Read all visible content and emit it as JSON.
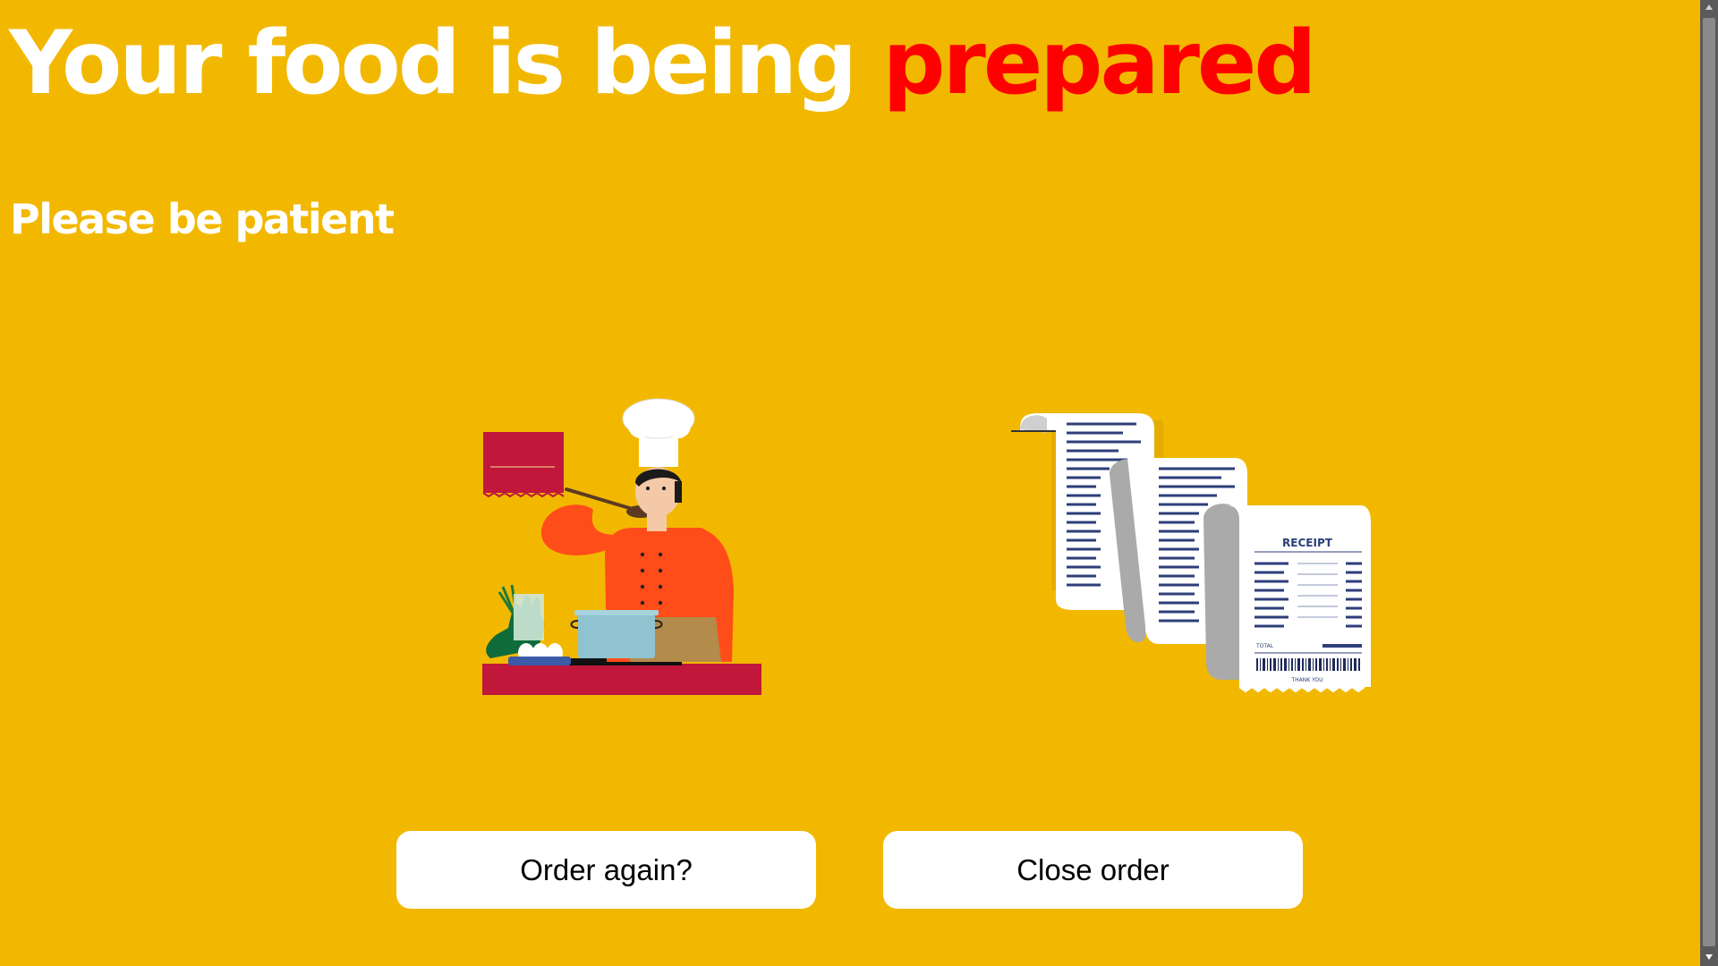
{
  "headline": {
    "text_main": "Your food is being ",
    "text_accent": "prepared",
    "accent_color": "#ff0000"
  },
  "subhead": {
    "text": "Please be patient"
  },
  "illustrations": {
    "chef": "chef-tasting-icon",
    "receipt": "receipt-icon",
    "receipt_title": "RECEIPT",
    "receipt_total": "TOTAL",
    "receipt_thanks": "THANK YOU"
  },
  "actions": {
    "order_again_label": "Order again?",
    "close_order_label": "Close order"
  },
  "colors": {
    "background": "#f2b800",
    "text": "#ffffff",
    "accent": "#ff0000",
    "button_bg": "#ffffff"
  }
}
